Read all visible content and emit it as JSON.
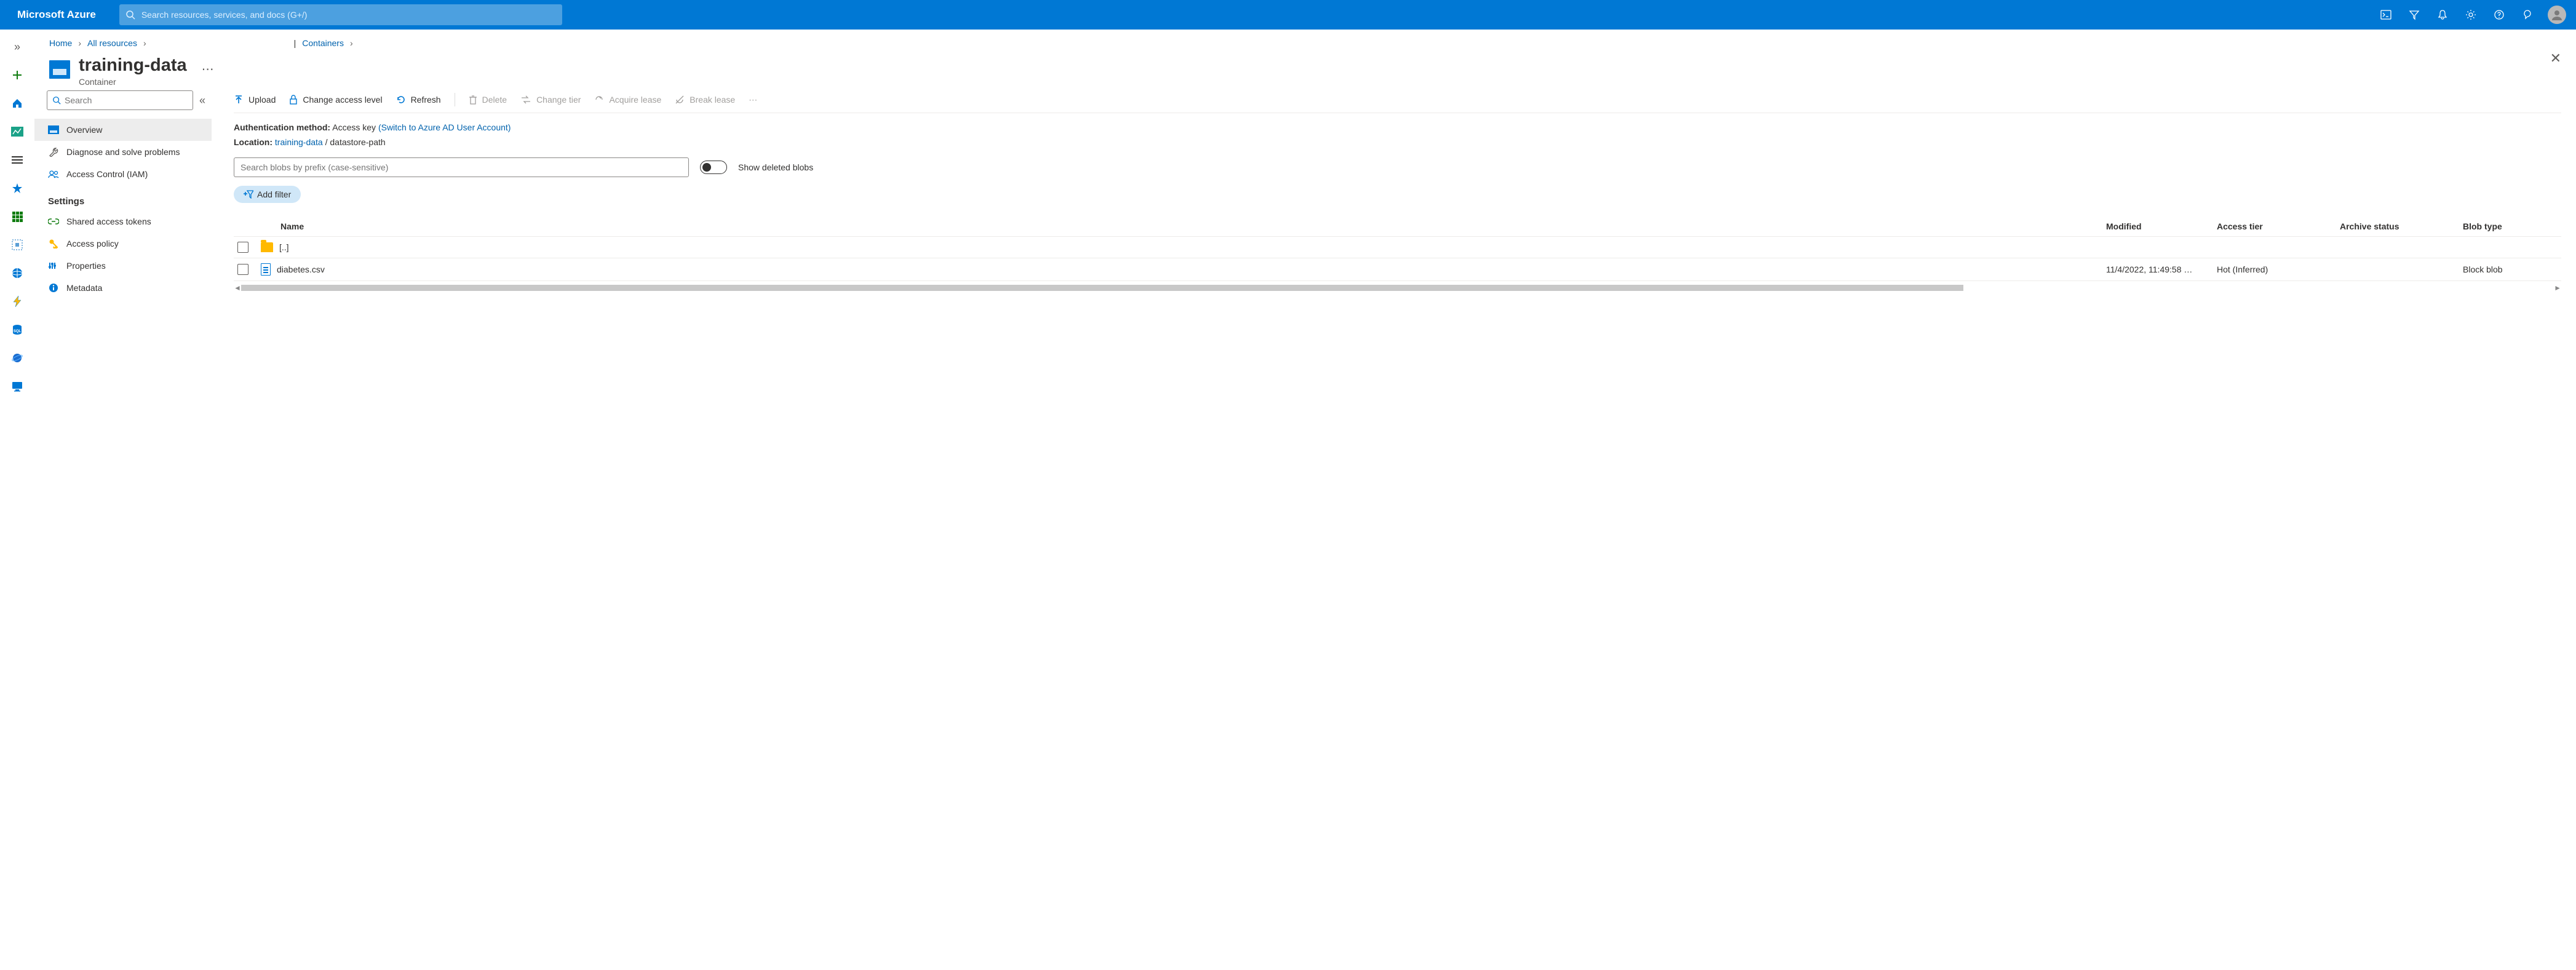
{
  "topbar": {
    "brand": "Microsoft Azure",
    "search_placeholder": "Search resources, services, and docs (G+/)"
  },
  "breadcrumb": {
    "home": "Home",
    "all_resources": "All resources",
    "containers_sep": "|",
    "containers": "Containers"
  },
  "header": {
    "title": "training-data",
    "subtitle": "Container"
  },
  "sidebar": {
    "search_placeholder": "Search",
    "overview": "Overview",
    "diagnose": "Diagnose and solve problems",
    "iam": "Access Control (IAM)",
    "settings_heading": "Settings",
    "shared_tokens": "Shared access tokens",
    "access_policy": "Access policy",
    "properties": "Properties",
    "metadata": "Metadata"
  },
  "toolbar": {
    "upload": "Upload",
    "change_access": "Change access level",
    "refresh": "Refresh",
    "delete": "Delete",
    "change_tier": "Change tier",
    "acquire": "Acquire lease",
    "break": "Break lease"
  },
  "meta": {
    "auth_label": "Authentication method:",
    "auth_value": "Access key",
    "auth_switch": "(Switch to Azure AD User Account)",
    "loc_label": "Location:",
    "loc_link": "training-data",
    "loc_path": "datastore-path"
  },
  "blob_search_placeholder": "Search blobs by prefix (case-sensitive)",
  "toggle_label": "Show deleted blobs",
  "add_filter": "Add filter",
  "table": {
    "headers": {
      "name": "Name",
      "modified": "Modified",
      "access_tier": "Access tier",
      "archive_status": "Archive status",
      "blob_type": "Blob type"
    },
    "rows": [
      {
        "name": "[..]",
        "modified": "",
        "access_tier": "",
        "archive_status": "",
        "blob_type": "",
        "kind": "folder"
      },
      {
        "name": "diabetes.csv",
        "modified": "11/4/2022, 11:49:58 …",
        "access_tier": "Hot (Inferred)",
        "archive_status": "",
        "blob_type": "Block blob",
        "kind": "file"
      }
    ]
  }
}
